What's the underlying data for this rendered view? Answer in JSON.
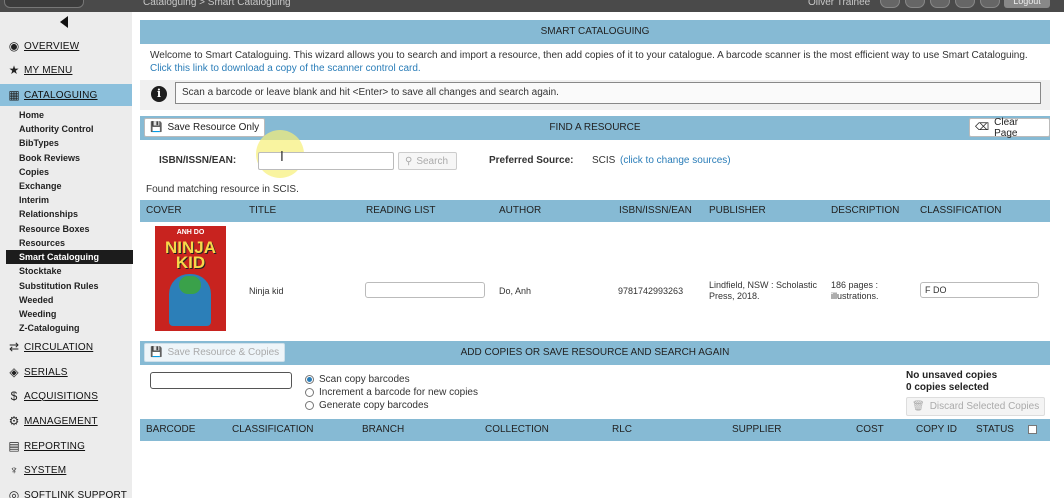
{
  "topbar": {
    "breadcrumb": "Cataloguing > Smart Cataloguing",
    "user": "Oliver Trainee",
    "logout_label": "Logout"
  },
  "sidebar": {
    "sections": [
      {
        "label": "OVERVIEW",
        "icon": "gauge-icon",
        "glyph": "◉"
      },
      {
        "label": "MY MENU",
        "icon": "star-icon",
        "glyph": "★"
      },
      {
        "label": "CATALOGUING",
        "icon": "book-icon",
        "glyph": "▦"
      },
      {
        "label": "CIRCULATION",
        "icon": "arrows-icon",
        "glyph": "⇄"
      },
      {
        "label": "SERIALS",
        "icon": "tag-icon",
        "glyph": "◈"
      },
      {
        "label": "ACQUISITIONS",
        "icon": "dollar-icon",
        "glyph": "$"
      },
      {
        "label": "MANAGEMENT",
        "icon": "gear-icon",
        "glyph": "⚙"
      },
      {
        "label": "REPORTING",
        "icon": "report-icon",
        "glyph": "▤"
      },
      {
        "label": "SYSTEM",
        "icon": "wrench-icon",
        "glyph": "♆"
      },
      {
        "label": "SOFTLINK SUPPORT",
        "icon": "support-icon",
        "glyph": "◎"
      }
    ],
    "cataloguing_items": [
      "Home",
      "Authority Control",
      "BibTypes",
      "Book Reviews",
      "Copies",
      "Exchange",
      "Interim",
      "Relationships",
      "Resource Boxes",
      "Resources",
      "Smart Cataloguing",
      "Stocktake",
      "Substitution Rules",
      "Weeded",
      "Weeding",
      "Z-Cataloguing"
    ]
  },
  "main": {
    "title": "SMART CATALOGUING",
    "welcome_text": "Welcome to Smart Cataloguing. This wizard allows you to search and import a resource, then add copies of it to your catalogue. A barcode scanner is the most efficient way to use Smart Cataloguing.",
    "welcome_link": "Click this link to download a copy of the scanner control card.",
    "info_message": "Scan a barcode or leave blank and hit <Enter> to save all changes and search again."
  },
  "find": {
    "title": "FIND A RESOURCE",
    "save_only_label": "Save Resource Only",
    "clear_label": "Clear Page",
    "isbn_label": "ISBN/ISSN/EAN:",
    "isbn_value": "",
    "search_label": "Search",
    "pref_source_label": "Preferred Source:",
    "pref_source_value": "SCIS",
    "change_sources_link": "(click to change sources)",
    "found_message": "Found matching resource in SCIS."
  },
  "results": {
    "columns": [
      "COVER",
      "TITLE",
      "READING LIST",
      "AUTHOR",
      "ISBN/ISSN/EAN",
      "PUBLISHER",
      "DESCRIPTION",
      "CLASSIFICATION"
    ],
    "row": {
      "cover_author": "ANH DO",
      "cover_title": "NINJA KID",
      "title": "Ninja kid",
      "reading_list": "",
      "author": "Do, Anh",
      "isbn": "9781742993263",
      "publisher": "Lindfield, NSW : Scholastic Press, 2018.",
      "description": "186 pages : illustrations.",
      "classification": "F DO"
    }
  },
  "copies": {
    "title": "ADD COPIES OR SAVE RESOURCE AND SEARCH AGAIN",
    "save_copies_label": "Save Resource & Copies",
    "options": [
      "Scan copy barcodes",
      "Increment a barcode for new copies",
      "Generate copy barcodes"
    ],
    "selected_option": "Scan copy barcodes",
    "unsaved_status": "No unsaved copies",
    "selected_status": "0 copies selected",
    "discard_label": "Discard Selected Copies",
    "columns": [
      "BARCODE",
      "CLASSIFICATION",
      "BRANCH",
      "COLLECTION",
      "RLC",
      "SUPPLIER",
      "COST",
      "COPY ID",
      "STATUS"
    ]
  },
  "colors": {
    "header_blue": "#86bad4",
    "active_item": "#1c1c1c",
    "link_blue": "#2a7db8"
  }
}
